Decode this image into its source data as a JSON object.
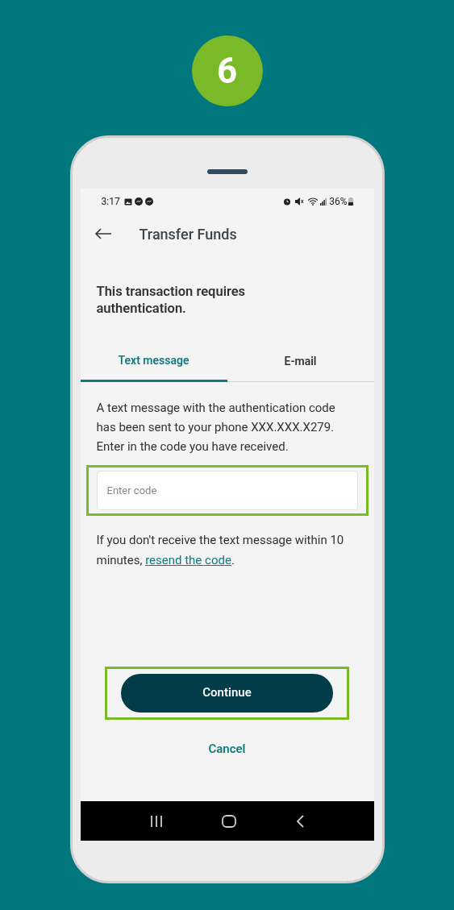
{
  "step_badge": "6",
  "status_bar": {
    "time": "3:17",
    "battery": "36%"
  },
  "app_bar": {
    "title": "Transfer Funds"
  },
  "heading": "This transaction requires authentication.",
  "tabs": [
    {
      "label": "Text message",
      "selected": true
    },
    {
      "label": "E-mail",
      "selected": false
    }
  ],
  "message": "A text message with the authentication code has been sent to your phone XXX.XXX.X279. Enter in the code you have received.",
  "code_field": {
    "placeholder": "Enter code",
    "highlighted": true
  },
  "resend_note": {
    "text": "If you don't receive the text message within 10 minutes, ",
    "link": "resend the code",
    "end": "."
  },
  "continue_button": {
    "label": "Continue",
    "highlighted": true
  },
  "cancel_link": "Cancel"
}
